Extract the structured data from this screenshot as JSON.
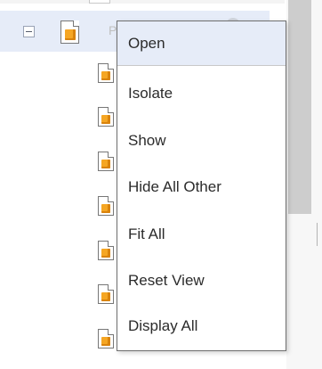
{
  "tree": {
    "selected_row_label": "P"
  },
  "context_menu": {
    "items": [
      {
        "label": "Open",
        "highlighted": true
      },
      {
        "label": "Isolate"
      },
      {
        "label": "Show"
      },
      {
        "label": "Hide All Other"
      },
      {
        "label": "Fit All"
      },
      {
        "label": "Reset View"
      },
      {
        "label": "Display All"
      }
    ]
  },
  "colors": {
    "selection": "#e6ecf8",
    "menu_border": "#6f6f6f",
    "icon_accent": "#f5a623"
  },
  "icons": {
    "expand": "minus-square-icon",
    "node": "part-document-icon"
  }
}
